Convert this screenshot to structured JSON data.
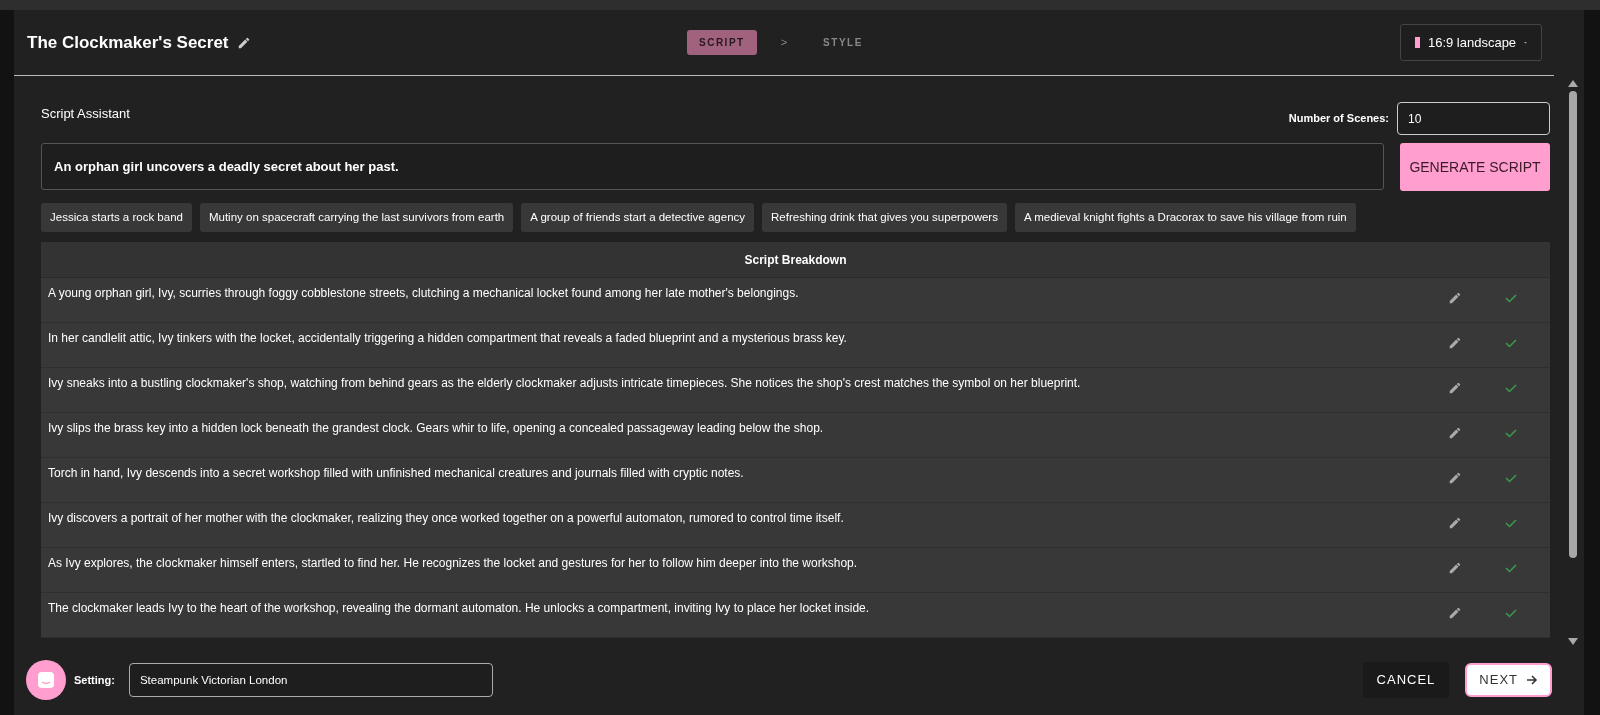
{
  "header": {
    "title": "The Clockmaker's Secret",
    "steps": [
      {
        "label": "SCRIPT",
        "selected": true
      },
      {
        "label": ">",
        "kind": "separator"
      },
      {
        "label": "STYLE",
        "selected": false
      }
    ],
    "aspect_dropdown": {
      "label": "16:9 landscape",
      "color": "#ff9ecf"
    }
  },
  "assistant": {
    "title": "Script Assistant",
    "scenes_label": "Number of Scenes:",
    "scenes_value": "10",
    "prompt_value": "An orphan girl uncovers a deadly secret about her past.",
    "generate_button": "GENERATE SCRIPT",
    "suggestions": [
      "Jessica starts a rock band",
      "Mutiny on spacecraft carrying the last survivors from earth",
      "A group of friends start a detective agency",
      "Refreshing drink that gives you superpowers",
      "A medieval knight fights a Dracorax to save his village from ruin"
    ]
  },
  "table": {
    "heading": "Script Breakdown",
    "rows": [
      {
        "text": "A young orphan girl, Ivy, scurries through foggy cobblestone streets, clutching a mechanical locket found among her late mother's belongings.",
        "approved": true
      },
      {
        "text": "In her candlelit attic, Ivy tinkers with the locket, accidentally triggering a hidden compartment that reveals a faded blueprint and a mysterious brass key.",
        "approved": true
      },
      {
        "text": "Ivy sneaks into a bustling clockmaker's shop, watching from behind gears as the elderly clockmaker adjusts intricate timepieces. She notices the shop's crest matches the symbol on her blueprint.",
        "approved": true
      },
      {
        "text": "Ivy slips the brass key into a hidden lock beneath the grandest clock. Gears whir to life, opening a concealed passageway leading below the shop.",
        "approved": true
      },
      {
        "text": "Torch in hand, Ivy descends into a secret workshop filled with unfinished mechanical creatures and journals filled with cryptic notes.",
        "approved": true
      },
      {
        "text": "Ivy discovers a portrait of her mother with the clockmaker, realizing they once worked together on a powerful automaton, rumored to control time itself.",
        "approved": true
      },
      {
        "text": "As Ivy explores, the clockmaker himself enters, startled to find her. He recognizes the locket and gestures for her to follow him deeper into the workshop.",
        "approved": true
      },
      {
        "text": "The clockmaker leads Ivy to the heart of the workshop, revealing the dormant automaton. He unlocks a compartment, inviting Ivy to place her locket inside.",
        "approved": true
      }
    ]
  },
  "footer": {
    "setting_label": "Setting:",
    "setting_value": "Steampunk Victorian London",
    "cancel_button": "CANCEL",
    "next_button": "NEXT"
  }
}
